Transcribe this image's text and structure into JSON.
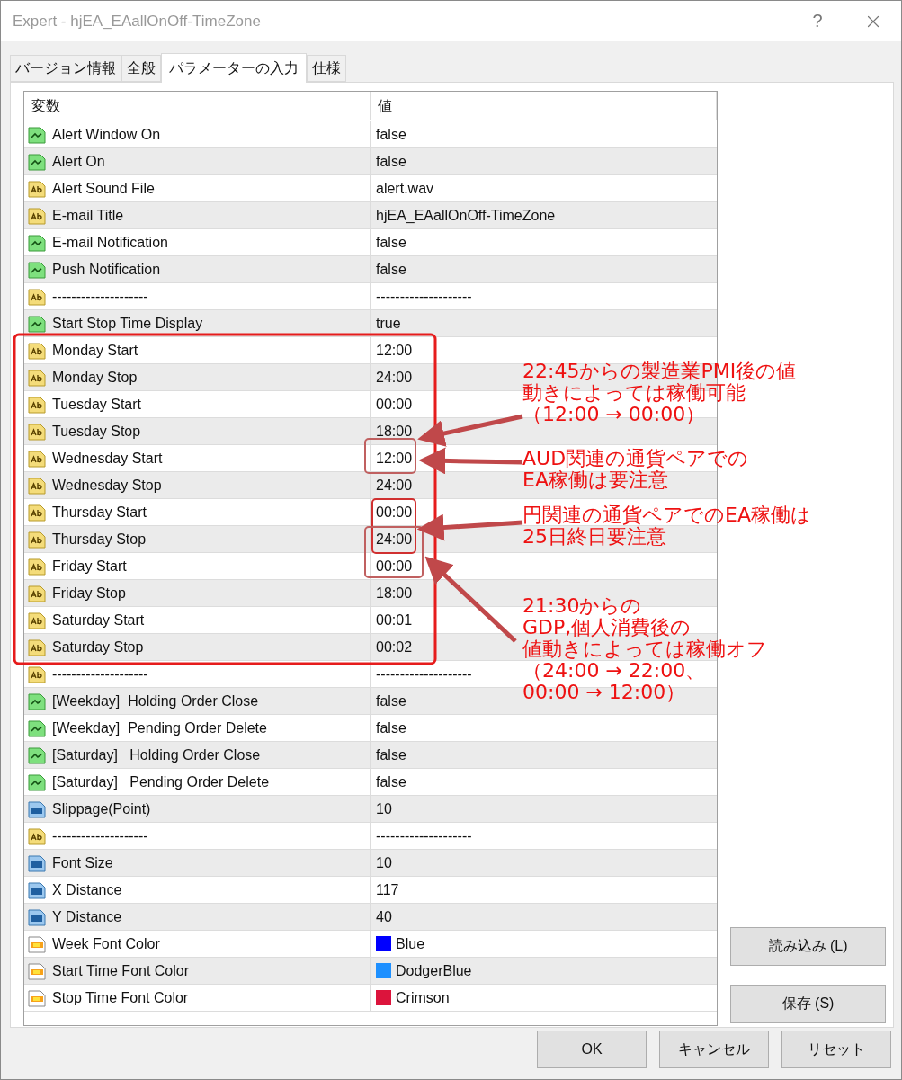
{
  "window": {
    "title": "Expert - hjEA_EAallOnOff-TimeZone",
    "help": "?"
  },
  "tabs": [
    {
      "label": "バージョン情報",
      "selected": false
    },
    {
      "label": "全般",
      "selected": false
    },
    {
      "label": "パラメーターの入力",
      "selected": true
    },
    {
      "label": "仕様",
      "selected": false
    }
  ],
  "table": {
    "columns": [
      "変数",
      "値"
    ],
    "rows": [
      {
        "kind": "bool",
        "name": "Alert Window On",
        "value": "false"
      },
      {
        "kind": "bool",
        "name": "Alert On",
        "value": "false"
      },
      {
        "kind": "string",
        "name": "Alert Sound File",
        "value": "alert.wav"
      },
      {
        "kind": "string",
        "name": "E-mail Title",
        "value": "hjEA_EAallOnOff-TimeZone"
      },
      {
        "kind": "bool",
        "name": "E-mail Notification",
        "value": "false"
      },
      {
        "kind": "bool",
        "name": "Push Notification",
        "value": "false"
      },
      {
        "kind": "string",
        "name": "--------------------",
        "value": "--------------------"
      },
      {
        "kind": "bool",
        "name": "Start Stop Time Display",
        "value": "true"
      },
      {
        "kind": "string",
        "name": "Monday Start",
        "value": "12:00"
      },
      {
        "kind": "string",
        "name": "Monday Stop",
        "value": "24:00"
      },
      {
        "kind": "string",
        "name": "Tuesday Start",
        "value": "00:00"
      },
      {
        "kind": "string",
        "name": "Tuesday Stop",
        "value": "18:00"
      },
      {
        "kind": "string",
        "name": "Wednesday Start",
        "value": "12:00"
      },
      {
        "kind": "string",
        "name": "Wednesday Stop",
        "value": "24:00"
      },
      {
        "kind": "string",
        "name": "Thursday Start",
        "value": "00:00"
      },
      {
        "kind": "string",
        "name": "Thursday Stop",
        "value": "24:00"
      },
      {
        "kind": "string",
        "name": "Friday Start",
        "value": "00:00"
      },
      {
        "kind": "string",
        "name": "Friday Stop",
        "value": "18:00"
      },
      {
        "kind": "string",
        "name": "Saturday Start",
        "value": "00:01"
      },
      {
        "kind": "string",
        "name": "Saturday Stop",
        "value": "00:02"
      },
      {
        "kind": "string",
        "name": "--------------------",
        "value": "--------------------"
      },
      {
        "kind": "bool",
        "name": "[Weekday]  Holding Order Close",
        "value": "false"
      },
      {
        "kind": "bool",
        "name": "[Weekday]  Pending Order Delete",
        "value": "false"
      },
      {
        "kind": "bool",
        "name": "[Saturday]   Holding Order Close",
        "value": "false"
      },
      {
        "kind": "bool",
        "name": "[Saturday]   Pending Order Delete",
        "value": "false"
      },
      {
        "kind": "int",
        "name": "Slippage(Point)",
        "value": "10"
      },
      {
        "kind": "string",
        "name": "--------------------",
        "value": "--------------------"
      },
      {
        "kind": "int",
        "name": "Font Size",
        "value": "10"
      },
      {
        "kind": "int",
        "name": "X Distance",
        "value": "117"
      },
      {
        "kind": "int",
        "name": "Y Distance",
        "value": "40"
      },
      {
        "kind": "color",
        "name": "Week Font Color",
        "value": "Blue",
        "color": "#0000ff"
      },
      {
        "kind": "color",
        "name": "Start Time Font Color",
        "value": "DodgerBlue",
        "color": "#1e90ff"
      },
      {
        "kind": "color",
        "name": "Stop Time Font Color",
        "value": "Crimson",
        "color": "#dc143c"
      }
    ]
  },
  "side_buttons": [
    "読み込み (L)",
    "保存 (S)"
  ],
  "buttons": [
    "OK",
    "キャンセル",
    "リセット"
  ],
  "annotations": [
    {
      "lines": [
        "22:45からの製造業PMI後の値",
        "動きによっては稼働可能",
        "（12:00 → 00:00）"
      ]
    },
    {
      "lines": [
        "AUD関連の通貨ペアでの",
        "EA稼働は要注意"
      ]
    },
    {
      "lines": [
        "円関連の通貨ペアでのEA稼働は",
        "25日終日要注意"
      ]
    },
    {
      "lines": [
        "21:30からの",
        "GDP,個人消費後の",
        "値動きによっては稼働オフ",
        "（24:00 → 22:00、",
        "00:00 → 12:00）"
      ]
    }
  ]
}
